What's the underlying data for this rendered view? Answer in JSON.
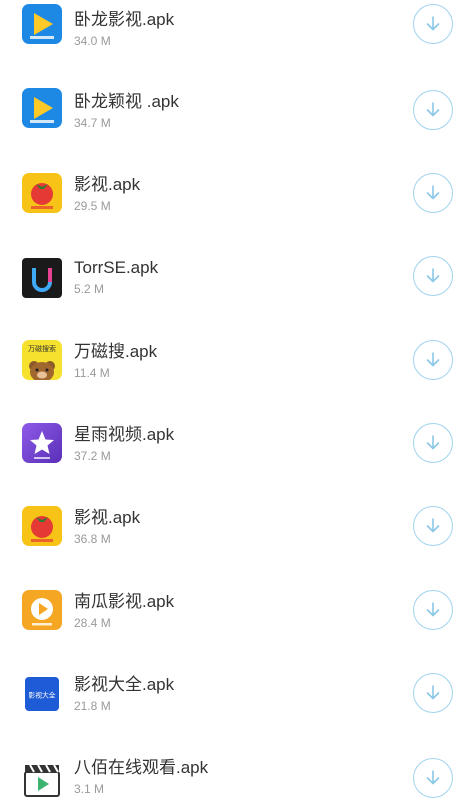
{
  "files": [
    {
      "name": "卧龙影视.apk",
      "size": "34.0 M",
      "icon": "wolong-play-icon",
      "accent": "#1E88E5"
    },
    {
      "name": "卧龙颖视 .apk",
      "size": "34.7 M",
      "icon": "wolong-play-icon",
      "accent": "#1E88E5"
    },
    {
      "name": "影视.apk",
      "size": "29.5 M",
      "icon": "tomato-icon",
      "accent": "#F7C316"
    },
    {
      "name": "TorrSE.apk",
      "size": "5.2 M",
      "icon": "torrse-u-icon",
      "accent": "#1A1A1A"
    },
    {
      "name": "万磁搜.apk",
      "size": "11.4 M",
      "icon": "bear-icon",
      "accent": "#F5E12E",
      "icon_text": "万磁搜索"
    },
    {
      "name": "星雨视频.apk",
      "size": "37.2 M",
      "icon": "purple-star-icon",
      "accent": "#6A3FC9"
    },
    {
      "name": "影视.apk",
      "size": "36.8 M",
      "icon": "tomato-icon",
      "accent": "#F7C316"
    },
    {
      "name": "南瓜影视.apk",
      "size": "28.4 M",
      "icon": "pumpkin-play-icon",
      "accent": "#F5A623"
    },
    {
      "name": "影视大全.apk",
      "size": "21.8 M",
      "icon": "video-encyclopedia-icon",
      "accent": "#1E5BD6",
      "icon_text": "影视大全"
    },
    {
      "name": "八佰在线观看.apk",
      "size": "3.1 M",
      "icon": "clapperboard-icon",
      "accent": "#333333"
    }
  ],
  "download_icon": "download-arrow-icon",
  "download_color": "#9FD3EE"
}
